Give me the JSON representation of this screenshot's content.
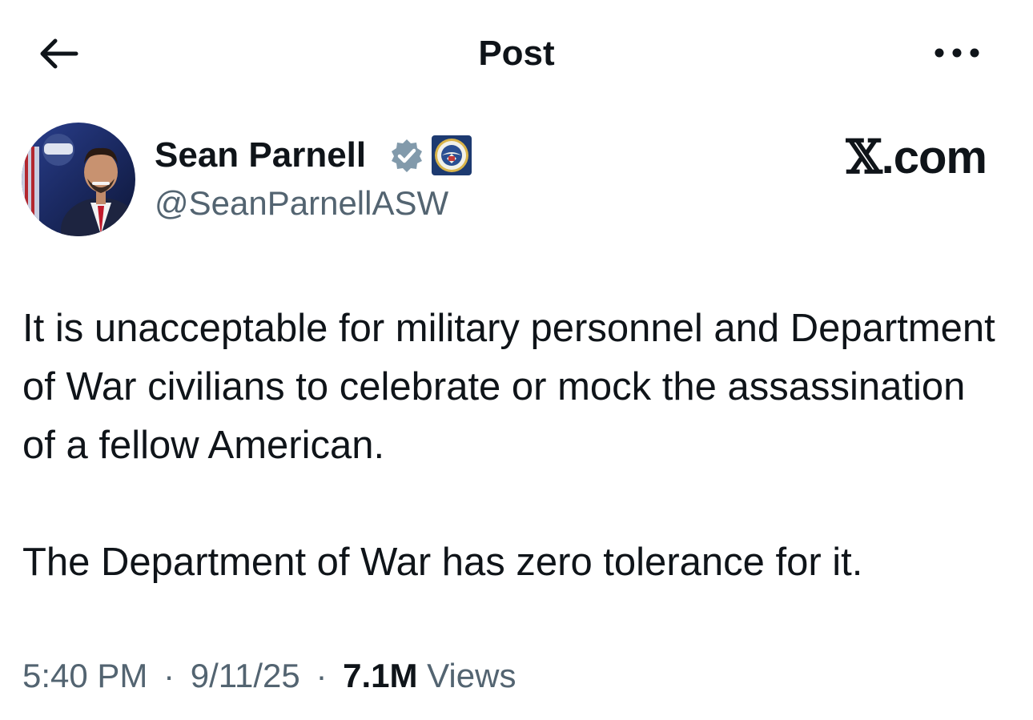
{
  "header": {
    "title": "Post",
    "back_icon": "arrow-left-icon",
    "more_icon": "more-horizontal-icon"
  },
  "author": {
    "name": "Sean Parnell",
    "handle": "@SeanParnellASW",
    "verified_icon": "verified-badge-icon",
    "verified_color": "#829aab",
    "affiliation_badge_icon": "department-seal-icon"
  },
  "watermark": {
    "x_letter": "𝕏",
    "suffix": ".com"
  },
  "post": {
    "paragraphs": [
      "It is unacceptable for military personnel and Department of War civilians to celebrate or mock the assassination of a fellow American.",
      "The Department of War has zero tolerance for it."
    ]
  },
  "meta": {
    "time": "5:40 PM",
    "separator": "·",
    "date": "9/11/25",
    "views_count": "7.1M",
    "views_label": "Views"
  },
  "colors": {
    "text_primary": "#0f1419",
    "text_secondary": "#536471",
    "background": "#ffffff"
  }
}
